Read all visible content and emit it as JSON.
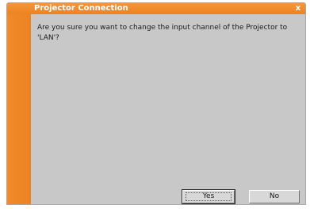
{
  "dialog": {
    "title": "Projector Connection",
    "close_label": "x",
    "message": "Are you sure you want to change the input channel of the Projector to 'LAN'?",
    "buttons": {
      "yes_label": "Yes",
      "no_label": "No"
    }
  },
  "colors": {
    "accent": "#ee8220",
    "dialog_background": "#c8c8c8",
    "title_text": "#ffffff"
  }
}
